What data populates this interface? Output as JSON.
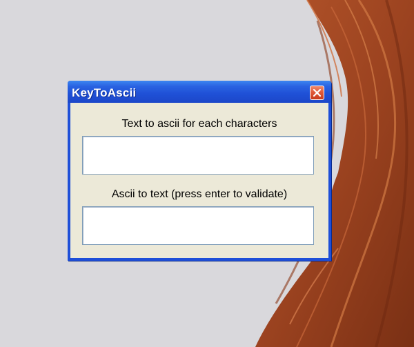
{
  "window": {
    "title": "KeyToAscii",
    "close_icon": "close-icon"
  },
  "text_to_ascii": {
    "label": "Text to ascii for each characters",
    "value": ""
  },
  "ascii_to_text": {
    "label": "Ascii to text (press enter to validate)",
    "value": ""
  },
  "colors": {
    "titlebar": "#2a63e2",
    "client": "#ece9d8",
    "close_button": "#e05a3a",
    "desktop": "#d9d8dc"
  }
}
